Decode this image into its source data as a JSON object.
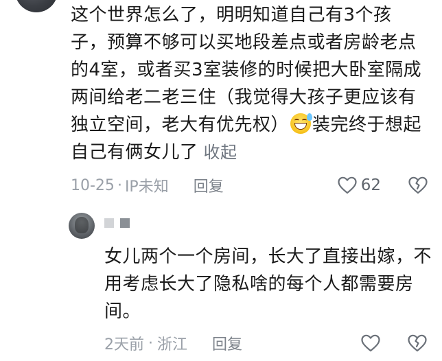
{
  "comment": {
    "text_before_emoji": "这个世界怎么了，明明知道自己有3个孩子，预算不够可以买地段差点或者房龄老点的4室，或者买3室装修的时候把大卧室隔成两间给老二老三住（我觉得大孩子更应该有独立空间，老大有优先权）",
    "emoji": "grinning-sweat-emoji",
    "text_after_emoji": "装完终于想起自己有俩女儿了",
    "collapse_label": "收起",
    "date": "10-25",
    "separator": "·",
    "location": "IP未知",
    "reply_label": "回复",
    "like_count": "62"
  },
  "reply": {
    "text": "女儿两个一个房间，长大了直接出嫁，不用考虑长大了隐私啥的每个人都需要房间。",
    "date": "2天前",
    "separator": "·",
    "location": "浙江",
    "reply_label": "回复"
  },
  "icons": {
    "like": "heart-outline-icon",
    "dislike": "broken-heart-icon"
  },
  "colors": {
    "text": "#1b1b1b",
    "meta": "#9aa0a8",
    "link": "#6f7680"
  }
}
